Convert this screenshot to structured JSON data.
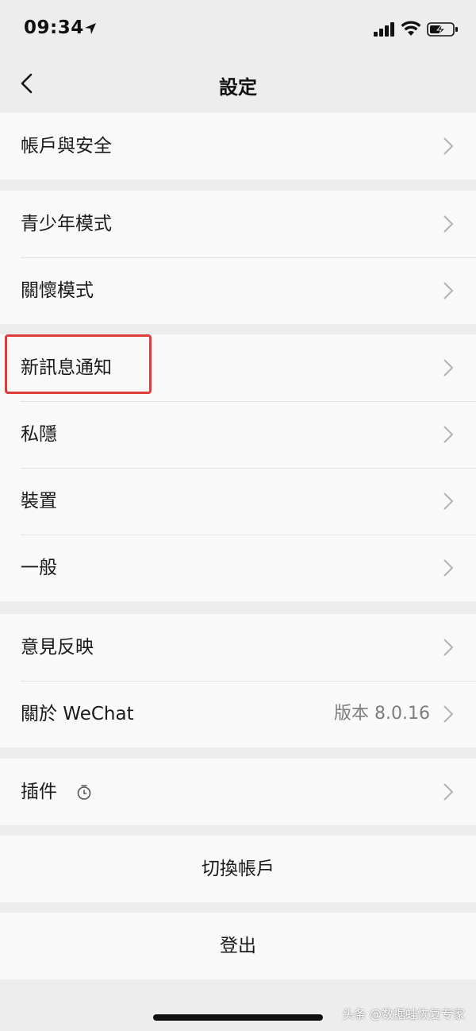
{
  "status_bar": {
    "time": "09:34",
    "icons": [
      "location-arrow-icon",
      "signal-icon",
      "wifi-icon",
      "battery-charging-icon"
    ]
  },
  "nav": {
    "title": "設定",
    "back_icon": "chevron-left-icon"
  },
  "groups": [
    {
      "items": [
        {
          "label": "帳戶與安全"
        }
      ]
    },
    {
      "items": [
        {
          "label": "青少年模式"
        },
        {
          "label": "關懷模式"
        }
      ]
    },
    {
      "items": [
        {
          "label": "新訊息通知",
          "highlighted": true
        },
        {
          "label": "私隱"
        },
        {
          "label": "裝置"
        },
        {
          "label": "一般"
        }
      ]
    },
    {
      "items": [
        {
          "label": "意見反映"
        },
        {
          "label": "關於 WeChat",
          "value": "版本 8.0.16"
        }
      ]
    },
    {
      "items": [
        {
          "label": "插件",
          "icon": "stopwatch-icon"
        }
      ]
    }
  ],
  "actions": {
    "switch_account": "切換帳戶",
    "logout": "登出"
  },
  "watermark": "头条 @数据蛙恢复专家",
  "colors": {
    "background": "#ededed",
    "cell": "#f9f9f9",
    "highlight": "#e03c3c",
    "secondary_text": "#7d7d7d"
  }
}
